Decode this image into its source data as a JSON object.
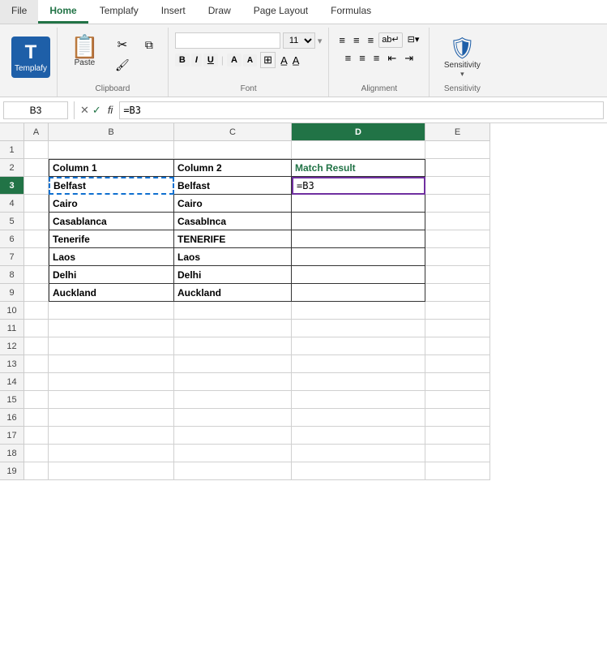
{
  "ribbon": {
    "tabs": [
      "File",
      "Home",
      "Templafy",
      "Insert",
      "Draw",
      "Page Layout",
      "Formulas"
    ],
    "active_tab": "Home",
    "groups": {
      "templafy": {
        "label": "Templafy",
        "icon": "T"
      },
      "clipboard": {
        "label": "Clipboard",
        "paste": "Paste",
        "cut": "✂",
        "copy": "⧉",
        "format_painter": "🖌"
      },
      "font": {
        "label": "Font",
        "font_name": "",
        "font_size": "11",
        "bold": "B",
        "italic": "I",
        "underline": "U",
        "increase": "A",
        "decrease": "A"
      },
      "alignment": {
        "label": "Alignment"
      },
      "sensitivity": {
        "label": "Sensitivity",
        "icon": "🛡"
      }
    }
  },
  "formula_bar": {
    "name_box": "B3",
    "formula": "=B3"
  },
  "spreadsheet": {
    "columns": [
      "",
      "A",
      "B",
      "C",
      "D",
      "E"
    ],
    "active_col": "D",
    "active_row": 3,
    "cells": {
      "B2": "Column 1",
      "C2": "Column 2",
      "D2": "Match Result",
      "B3": "Belfast",
      "C3": "Belfast",
      "D3": "=B3",
      "B4": "Cairo",
      "C4": "Cairo",
      "B5": "Casablanca",
      "C5": "CasabInca",
      "B6": "Tenerife",
      "C6": "TENERIFE",
      "B7": "Laos",
      "C7": "Laos",
      "B8": "Delhi",
      "C8": "Delhi",
      "B9": "Auckland",
      "C9": "Auckland"
    },
    "rows": [
      1,
      2,
      3,
      4,
      5,
      6,
      7,
      8,
      9,
      10,
      11,
      12,
      13,
      14,
      15,
      16,
      17,
      18,
      19
    ]
  }
}
